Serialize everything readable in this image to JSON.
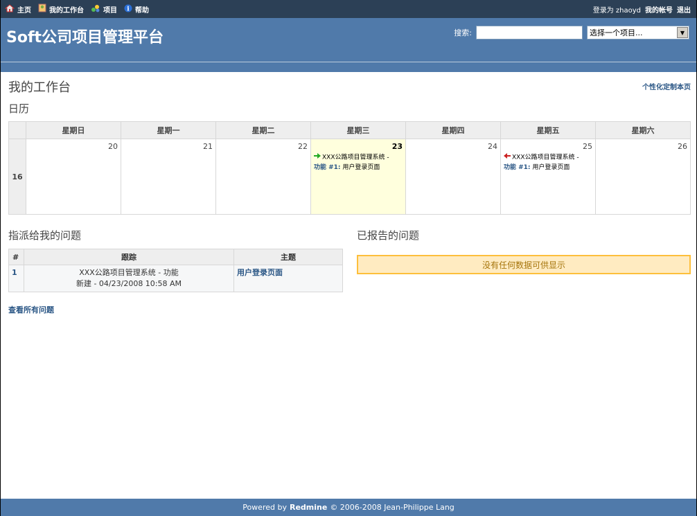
{
  "top_menu": {
    "items": [
      {
        "label": "主页",
        "icon": "home-icon"
      },
      {
        "label": "我的工作台",
        "icon": "mypage-icon"
      },
      {
        "label": "项目",
        "icon": "projects-icon"
      },
      {
        "label": "帮助",
        "icon": "help-icon"
      }
    ],
    "logged_as": "登录为 zhaoyd",
    "my_account": "我的帐号",
    "logout": "退出"
  },
  "header": {
    "title": "Soft公司项目管理平台",
    "search_label": "搜索:",
    "search_value": "",
    "project_select": "选择一个项目..."
  },
  "main": {
    "page_title": "我的工作台",
    "personalize_link": "个性化定制本页",
    "calendar_title": "日历",
    "calendar": {
      "weekdays": [
        "星期日",
        "星期一",
        "星期二",
        "星期三",
        "星期四",
        "星期五",
        "星期六"
      ],
      "week_number": "16",
      "days": [
        "20",
        "21",
        "22",
        "23",
        "24",
        "25",
        "26"
      ],
      "issues": {
        "wed": {
          "project": "XXX公路项目管理系统 -",
          "tracker": "功能 #1:",
          "subject": "用户登录页面",
          "arrow": "start-arrow-icon"
        },
        "fri": {
          "project": "XXX公路项目管理系统 -",
          "tracker": "功能 #1:",
          "subject": "用户登录页面",
          "arrow": "end-arrow-icon"
        }
      }
    },
    "assigned_title": "指派给我的问题",
    "assigned_table": {
      "headers": [
        "#",
        "跟踪",
        "主题"
      ],
      "rows": [
        {
          "id": "1",
          "tracker_line1": "XXX公路项目管理系统 - 功能",
          "tracker_line2": "新建 - 04/23/2008 10:58 AM",
          "subject": "用户登录页面"
        }
      ]
    },
    "reported_title": "已报告的问题",
    "no_data": "没有任何数据可供显示",
    "view_all": "查看所有问题"
  },
  "footer": {
    "powered_by": "Powered by",
    "redmine": "Redmine",
    "copyright": "© 2006-2008 Jean-Philippe Lang"
  },
  "colors": {
    "top_menu_bg": "#2C4056",
    "header_bg": "#507AAA",
    "link": "#2A5685",
    "today_bg": "#ffffdd",
    "nodata_bg": "#FFEBC1",
    "nodata_border": "#FDBF3B"
  }
}
